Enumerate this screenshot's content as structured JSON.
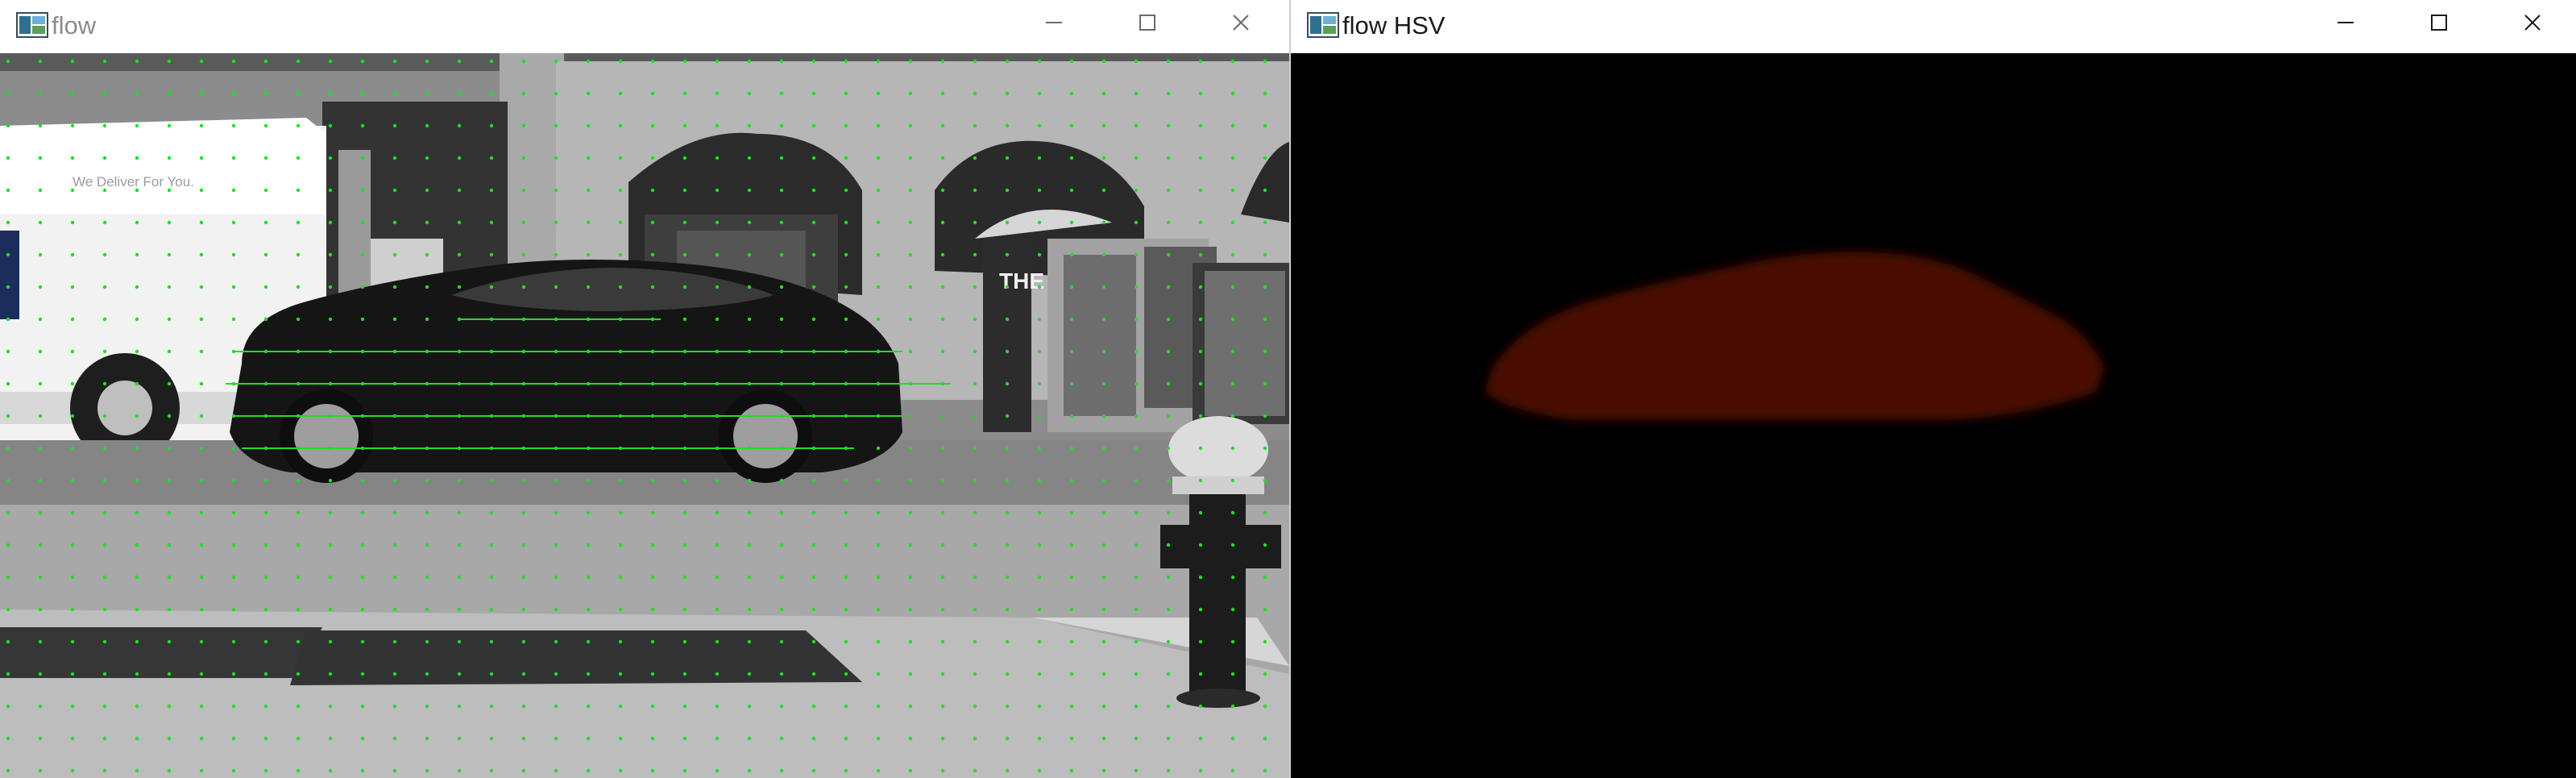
{
  "windows": [
    {
      "title": "flow",
      "controls": [
        "minimize-icon",
        "maximize-icon",
        "close-icon"
      ]
    },
    {
      "title": "flow HSV",
      "controls": [
        "minimize-icon",
        "maximize-icon",
        "close-icon"
      ]
    }
  ],
  "scene": {
    "truck_lettering": "We Deliver For You.",
    "stall_sign": "THE"
  },
  "colors": {
    "flow_vector": "#22dd22",
    "hsv_motion": "#4a0704",
    "hsv_background": "#000000"
  }
}
